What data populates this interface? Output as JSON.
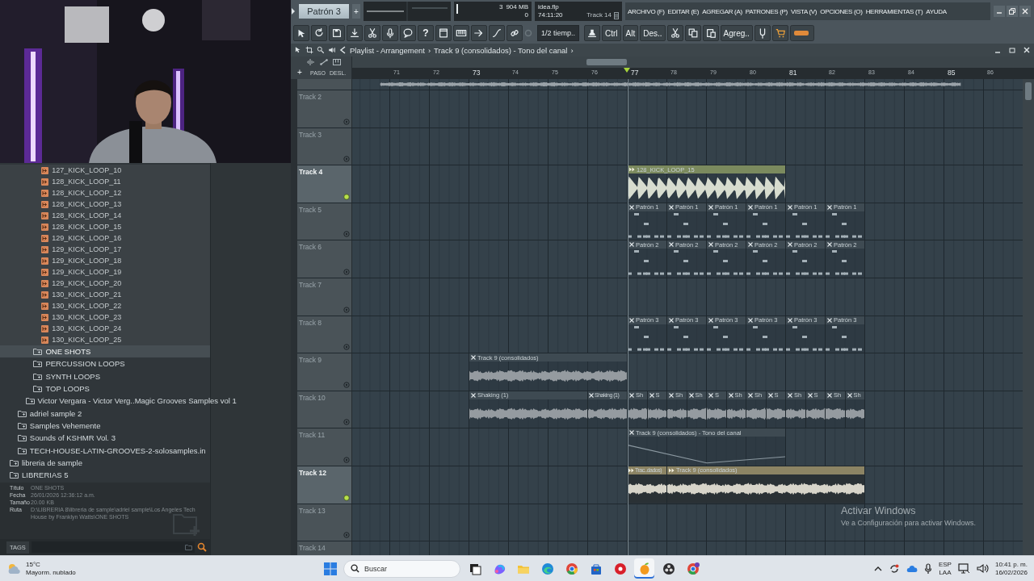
{
  "top_bar": {
    "pattern": "Patrón 3",
    "add": "+",
    "cpu": {
      "value": "3",
      "memory": "904 MB",
      "polyphony": "0"
    },
    "hint": {
      "file": "idea.flp",
      "time": "74:11:20",
      "track": "Track 14"
    }
  },
  "menu": [
    "ARCHIVO (F)",
    "EDITAR (E)",
    "AGREGAR (A)",
    "PATRONES (P)",
    "VISTA (V)",
    "OPCIONES (O)",
    "HERRAMIENTAS (T)",
    "AYUDA"
  ],
  "toolbar": {
    "buttons": [
      "?",
      "Ctrl",
      "Alt",
      "Des..",
      "Agreg.."
    ],
    "snap": "1/2 tiemp.."
  },
  "playlist": {
    "title": "Playlist - Arrangement",
    "separator": "›",
    "path": "Track 9 (consolidados) - Tono del canal",
    "path_end": "›"
  },
  "ruler": {
    "labels": [
      "PASO",
      "DESL."
    ],
    "add": "+",
    "bars": [
      "71",
      "72",
      "73",
      "74",
      "75",
      "76",
      "77",
      "78",
      "79",
      "80",
      "81",
      "82",
      "83",
      "84",
      "85",
      "86"
    ]
  },
  "tracks": [
    {
      "selected": false,
      "clips": [
        {
          "kind": "audio"
        }
      ]
    },
    {
      "name": "Track 2",
      "selected": false
    },
    {
      "name": "Track 3",
      "selected": false
    },
    {
      "name": "Track 4",
      "selected": true,
      "clips": [
        {
          "kind": "pulse",
          "name": "128_KICK_LOOP_15",
          "closable": false,
          "color": "#7b8a5e"
        }
      ]
    },
    {
      "name": "Track 5",
      "selected": false,
      "clips": [
        {
          "kind": "pattern",
          "name": "Patrón 1",
          "closable": true,
          "color": "#3e4a52"
        },
        {
          "kind": "pattern",
          "name": "Patrón 1",
          "closable": true,
          "color": "#3e4a52"
        },
        {
          "kind": "pattern",
          "name": "Patrón 1",
          "closable": true,
          "color": "#3e4a52"
        },
        {
          "kind": "pattern",
          "name": "Patrón 1",
          "closable": true,
          "color": "#3e4a52"
        },
        {
          "kind": "pattern",
          "name": "Patrón 1",
          "closable": true,
          "color": "#3e4a52"
        },
        {
          "kind": "pattern",
          "name": "Patrón 1",
          "closable": true,
          "color": "#3e4a52"
        }
      ]
    },
    {
      "name": "Track 6",
      "selected": false,
      "clips": [
        {
          "kind": "pattern",
          "name": "Patrón 2",
          "closable": true,
          "color": "#3e4a52"
        },
        {
          "kind": "pattern",
          "name": "Patrón 2",
          "closable": true,
          "color": "#3e4a52"
        },
        {
          "kind": "pattern",
          "name": "Patrón 2",
          "closable": true,
          "color": "#3e4a52"
        },
        {
          "kind": "pattern",
          "name": "Patrón 2",
          "closable": true,
          "color": "#3e4a52"
        },
        {
          "kind": "pattern",
          "name": "Patrón 2",
          "closable": true,
          "color": "#3e4a52"
        },
        {
          "kind": "pattern",
          "name": "Patrón 2",
          "closable": true,
          "color": "#3e4a52"
        }
      ]
    },
    {
      "name": "Track 7",
      "selected": false
    },
    {
      "name": "Track 8",
      "selected": false,
      "clips": [
        {
          "kind": "pattern",
          "name": "Patrón 3",
          "closable": true,
          "color": "#3e4a52"
        },
        {
          "kind": "pattern",
          "name": "Patrón 3",
          "closable": true,
          "color": "#3e4a52"
        },
        {
          "kind": "pattern",
          "name": "Patrón 3",
          "closable": true,
          "color": "#3e4a52"
        },
        {
          "kind": "pattern",
          "name": "Patrón 3",
          "closable": true,
          "color": "#3e4a52"
        },
        {
          "kind": "pattern",
          "name": "Patrón 3",
          "closable": true,
          "color": "#3e4a52"
        },
        {
          "kind": "pattern",
          "name": "Patrón 3",
          "closable": true,
          "color": "#3e4a52"
        }
      ]
    },
    {
      "name": "Track 9",
      "selected": false,
      "clips": [
        {
          "kind": "audio",
          "name": "Track 9 (consolidados)",
          "closable": true,
          "color": "#3e4a52"
        }
      ]
    },
    {
      "name": "Track 10",
      "selected": false,
      "clips": [
        {
          "kind": "audio",
          "name": "Shaking (1)",
          "closable": true,
          "color": "#3e4a52"
        },
        {
          "kind": "audio",
          "name": "Shaking (1)",
          "closable": true,
          "color": "#3e4a52"
        },
        {
          "kind": "audio",
          "name": "Sh",
          "closable": true,
          "color": "#3e4a52"
        },
        {
          "kind": "audio",
          "name": "S",
          "closable": true,
          "color": "#3e4a52"
        },
        {
          "kind": "audio",
          "name": "Sh",
          "closable": true,
          "color": "#3e4a52"
        },
        {
          "kind": "audio",
          "name": "Sh",
          "closable": true,
          "color": "#3e4a52"
        },
        {
          "kind": "audio",
          "name": "S",
          "closable": true,
          "color": "#3e4a52"
        },
        {
          "kind": "audio",
          "name": "Sh",
          "closable": true,
          "color": "#3e4a52"
        },
        {
          "kind": "audio",
          "name": "Sh",
          "closable": true,
          "color": "#3e4a52"
        },
        {
          "kind": "audio",
          "name": "S",
          "closable": true,
          "color": "#3e4a52"
        },
        {
          "kind": "audio",
          "name": "Sh",
          "closable": true,
          "color": "#3e4a52"
        },
        {
          "kind": "audio",
          "name": "S",
          "closable": true,
          "color": "#3e4a52"
        },
        {
          "kind": "audio",
          "name": "Sh",
          "closable": true,
          "color": "#3e4a52"
        },
        {
          "kind": "audio",
          "name": "Sh",
          "closable": true,
          "color": "#3e4a52"
        }
      ]
    },
    {
      "name": "Track 11",
      "selected": false,
      "clips": [
        {
          "kind": "automation",
          "name": "Track 9 (consolidados) - Tono del canal",
          "closable": true,
          "color": "#3e4a52"
        }
      ]
    },
    {
      "name": "Track 12",
      "selected": true,
      "clips": [
        {
          "kind": "audio",
          "name": "Trac..dados)",
          "closable": false,
          "color": "#8c8464"
        },
        {
          "kind": "audio",
          "name": "Track 9 (consolidados)",
          "closable": false,
          "color": "#8c8464"
        }
      ]
    },
    {
      "name": "Track 13",
      "selected": false
    },
    {
      "name": "Track 14",
      "selected": false
    }
  ],
  "browser": {
    "tree": [
      {
        "children": [
          {
            "children": [
              {
                "children": [
                  {
                    "children": [
                      {
                        "kind": "file",
                        "label": "127_KICK_LOOP_10",
                        "selected": false
                      },
                      {
                        "kind": "file",
                        "label": "128_KICK_LOOP_11",
                        "selected": false
                      },
                      {
                        "kind": "file",
                        "label": "128_KICK_LOOP_12",
                        "selected": false
                      },
                      {
                        "kind": "file",
                        "label": "128_KICK_LOOP_13",
                        "selected": false
                      },
                      {
                        "kind": "file",
                        "label": "128_KICK_LOOP_14",
                        "selected": false
                      },
                      {
                        "kind": "file",
                        "label": "128_KICK_LOOP_15",
                        "selected": false
                      },
                      {
                        "kind": "file",
                        "label": "129_KICK_LOOP_16",
                        "selected": false
                      },
                      {
                        "kind": "file",
                        "label": "129_KICK_LOOP_17",
                        "selected": false
                      },
                      {
                        "kind": "file",
                        "label": "129_KICK_LOOP_18",
                        "selected": false
                      },
                      {
                        "kind": "file",
                        "label": "129_KICK_LOOP_19",
                        "selected": false
                      },
                      {
                        "kind": "file",
                        "label": "129_KICK_LOOP_20",
                        "selected": false
                      },
                      {
                        "kind": "file",
                        "label": "130_KICK_LOOP_21",
                        "selected": false
                      },
                      {
                        "kind": "file",
                        "label": "130_KICK_LOOP_22",
                        "selected": false
                      },
                      {
                        "kind": "file",
                        "label": "130_KICK_LOOP_23",
                        "selected": false
                      },
                      {
                        "kind": "file",
                        "label": "130_KICK_LOOP_24",
                        "selected": false
                      },
                      {
                        "kind": "file",
                        "label": "130_KICK_LOOP_25",
                        "selected": false
                      }
                    ]
                  },
                  {
                    "kind": "folder",
                    "label": "ONE SHOTS",
                    "selected": true
                  },
                  {
                    "kind": "folder",
                    "label": "PERCUSSION LOOPS",
                    "selected": false
                  },
                  {
                    "kind": "folder",
                    "label": "SYNTH LOOPS",
                    "selected": false
                  },
                  {
                    "kind": "folder",
                    "label": "TOP LOOPS",
                    "selected": false
                  }
                ]
              },
              {
                "kind": "folder",
                "label": "Victor Vergara - Victor Verg..Magic Grooves Samples vol 1",
                "selected": false
              }
            ]
          },
          {
            "kind": "folder",
            "label": "adriel sample 2",
            "selected": false
          },
          {
            "kind": "folder",
            "label": "Samples Vehemente",
            "selected": false
          },
          {
            "kind": "folder",
            "label": "Sounds of KSHMR Vol. 3",
            "selected": false
          },
          {
            "kind": "folder",
            "label": "TECH-HOUSE-LATIN-GROOVES-2-solosamples.in",
            "selected": false
          }
        ]
      },
      {
        "kind": "folder",
        "label": "libreria de sample",
        "selected": false
      },
      {
        "kind": "folder",
        "label": "LIBRERIAS 5",
        "selected": false
      }
    ],
    "info": [
      {
        "label": "Título",
        "value": "ONE SHOTS"
      },
      {
        "label": "Fecha",
        "value": "26/01/2026 12:36:12 a.m."
      },
      {
        "label": "Tamaño",
        "value": "20.00 KB"
      },
      {
        "label": "Ruta",
        "value": "D:\\LIBRERIA 8\\libreria de sample\\adriel sample\\Los Angeles Tech House by Franklyn Watts\\ONE SHOTS"
      }
    ],
    "tags": "TAGS"
  },
  "taskbar": {
    "weather": {
      "temp": "15°C",
      "condition": "Mayorm. nublado"
    },
    "search": "Buscar",
    "apps": [
      {
        "selected": false
      },
      {
        "selected": false
      },
      {
        "selected": false
      },
      {
        "selected": false
      },
      {
        "selected": false
      },
      {
        "selected": false
      },
      {
        "selected": false
      },
      {
        "selected": true
      },
      {
        "selected": false
      },
      {
        "selected": false
      }
    ],
    "language": "ESP",
    "layout": "LAA",
    "time": "10:41 p. m.",
    "date": "16/02/2026"
  },
  "activation": {
    "title": "Activar Windows",
    "text": "Ve a Configuración para activar Windows."
  }
}
